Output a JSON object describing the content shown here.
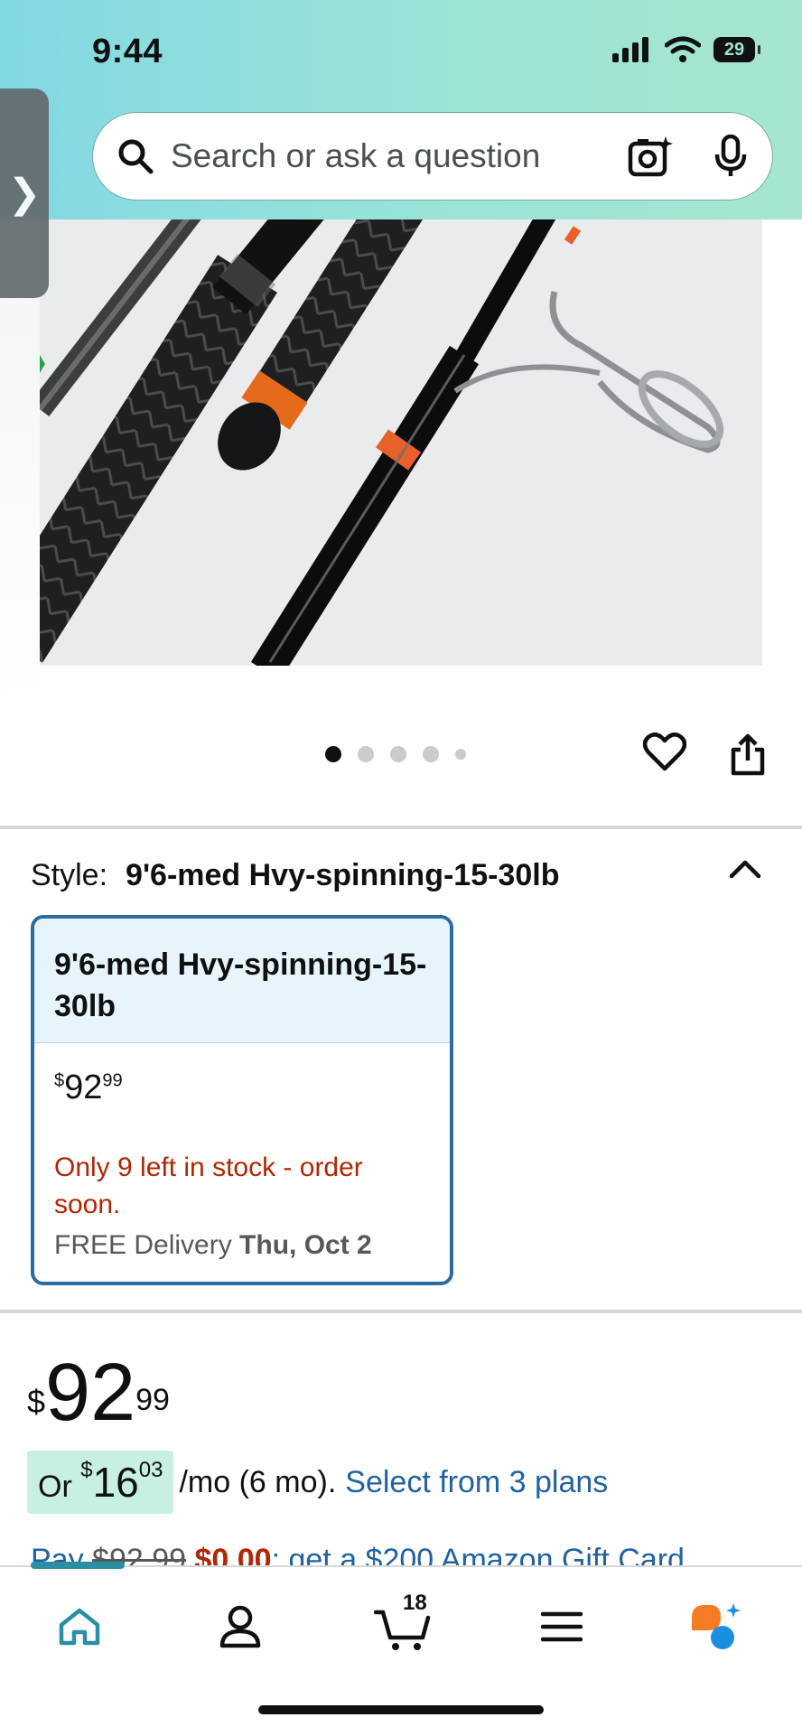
{
  "status_bar": {
    "time": "9:44",
    "battery": "29"
  },
  "search": {
    "placeholder": "Search or ask a question"
  },
  "gallery": {
    "dot_count": 5,
    "active_dot": 1
  },
  "style": {
    "label": "Style:",
    "selected": "9'6-med Hvy-spinning-15-30lb",
    "card": {
      "name": "9'6-med Hvy-spinning-15-30lb",
      "price_symbol": "$",
      "price_whole": "92",
      "price_fraction": "99",
      "stock_message": "Only 9 left in stock - order soon.",
      "delivery_prefix": "FREE Delivery",
      "delivery_date": "Thu, Oct 2"
    }
  },
  "price": {
    "symbol": "$",
    "whole": "92",
    "fraction": "99"
  },
  "installment": {
    "prefix": "Or",
    "symbol": "$",
    "whole": "16",
    "fraction": "03",
    "term": "/mo (6 mo).",
    "link": "Select from 3 plans"
  },
  "promo": {
    "pay": "Pay",
    "original": "$92.99",
    "discounted": "$0.00",
    "text": ": get a $200 Amazon Gift Card"
  },
  "bottom_nav": {
    "cart_count": "18"
  },
  "colors": {
    "accent_link": "#2162a1",
    "stock_red": "#b12704",
    "selection_border": "#2a6ca1",
    "installment_bg": "#c8f0e1"
  }
}
